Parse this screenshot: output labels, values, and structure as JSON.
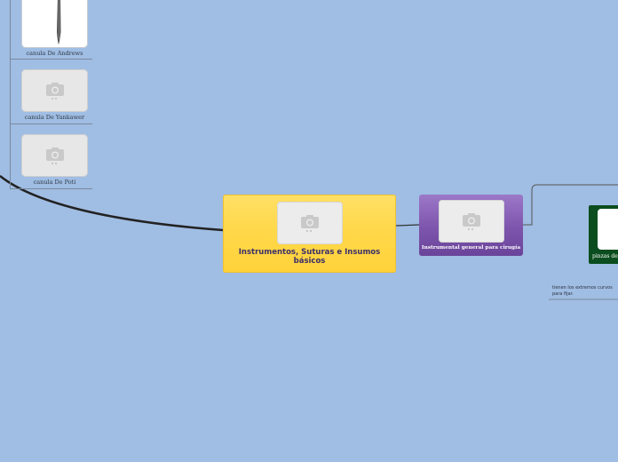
{
  "left_branch": {
    "items": [
      {
        "label": "canula De  Andrews",
        "image": "cannula-photo"
      },
      {
        "label": "canula De Yankawer",
        "image": "photo-placeholder-icon"
      },
      {
        "label": "canula De Poti",
        "image": "photo-placeholder-icon"
      }
    ]
  },
  "central": {
    "title": "Instrumentos, Suturas e Insumos básicos",
    "image": "photo-placeholder-icon"
  },
  "purple_node": {
    "title": "Instrumental general para cirugía",
    "image": "photo-placeholder-icon"
  },
  "green_node": {
    "title": "pinzas de"
  },
  "note": {
    "text": "tienen los extremos curvos para fijar."
  },
  "colors": {
    "background": "#a0bde3",
    "central_fill": "#ffd84a",
    "purple_fill": "#7d55ac",
    "green_fill": "#0b4d1e",
    "connector": "#222222"
  }
}
